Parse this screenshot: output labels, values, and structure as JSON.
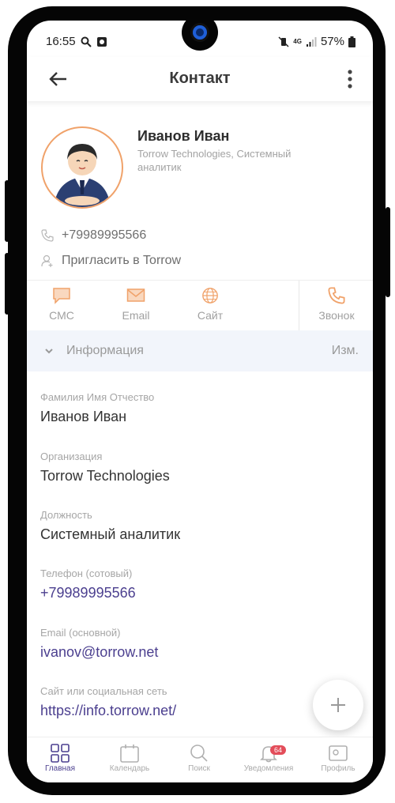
{
  "status": {
    "time": "16:55",
    "battery": "57%",
    "net": "4G"
  },
  "header": {
    "title": "Контакт"
  },
  "contact": {
    "name": "Иванов Иван",
    "subtitle": "Torrow Technologies, Системный аналитик",
    "phone": "+79989995566",
    "invite": "Пригласить в Torrow"
  },
  "actions": {
    "sms": "СМС",
    "email": "Email",
    "site": "Сайт",
    "call": "Звонок"
  },
  "info": {
    "title": "Информация",
    "edit": "Изм."
  },
  "fields": [
    {
      "label": "Фамилия Имя Отчество",
      "value": "Иванов Иван"
    },
    {
      "label": "Организация",
      "value": "Torrow Technologies"
    },
    {
      "label": "Должность",
      "value": "Системный аналитик"
    },
    {
      "label": "Телефон  (сотовый)",
      "value": "+79989995566"
    },
    {
      "label": "Email (основной)",
      "value": "ivanov@torrow.net"
    },
    {
      "label": "Сайт или социальная сеть",
      "value": "https://info.torrow.net/"
    }
  ],
  "nav": {
    "home": "Главная",
    "calendar": "Календарь",
    "search": "Поиск",
    "notifications": "Уведомления",
    "notifications_badge": "64",
    "profile": "Профиль"
  },
  "colors": {
    "accent": "#f0a26a",
    "link": "#4b3f8f",
    "badge": "#e34d5a",
    "info_bg": "#f2f5fb"
  }
}
